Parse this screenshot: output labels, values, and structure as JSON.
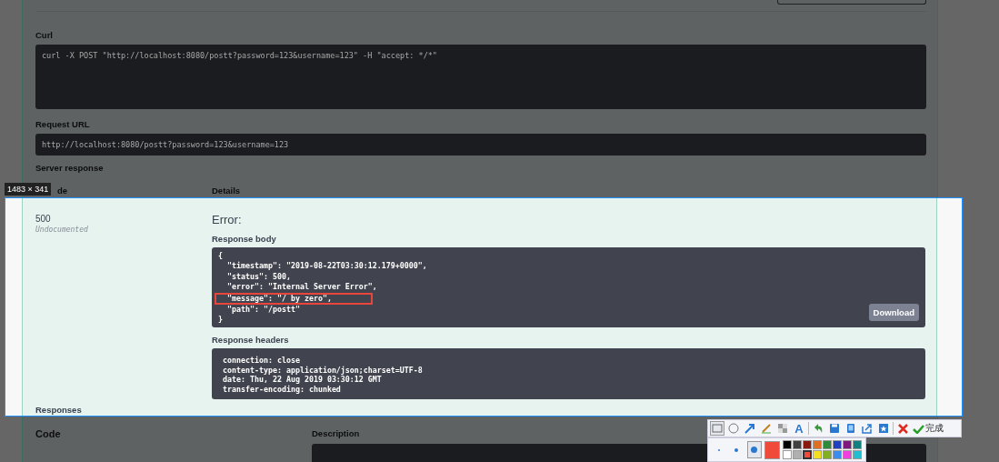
{
  "top_panel": {
    "curl_label": "Curl",
    "curl_command": "curl -X POST \"http://localhost:8080/postt?password=123&username=123\" -H \"accept: */*\"",
    "request_url_label": "Request URL",
    "request_url": "http://localhost:8080/postt?password=123&username=123",
    "server_response_label": "Server response",
    "columns": [
      "de",
      "Details"
    ]
  },
  "server_response": {
    "code": "500",
    "code_note": "Undocumented",
    "details_title": "Error:",
    "response_body_label": "Response body",
    "response_body": [
      {
        "text": "{",
        "highlighted": false
      },
      {
        "text": "  \"timestamp\": \"2019-08-22T03:30:12.179+0000\",",
        "highlighted": false
      },
      {
        "text": "  \"status\": 500,",
        "highlighted": false
      },
      {
        "text": "  \"error\": \"Internal Server Error\",",
        "highlighted": false
      },
      {
        "text": "  \"message\": \"/ by zero\",",
        "highlighted": true
      },
      {
        "text": "  \"path\": \"/postt\"",
        "highlighted": false
      },
      {
        "text": "}",
        "highlighted": false
      }
    ],
    "download_button": "Download",
    "response_headers_label": "Response headers",
    "response_headers": [
      " connection: close",
      " content-type: application/json;charset=UTF-8",
      " date: Thu, 22 Aug 2019 03:30:12 GMT",
      " transfer-encoding: chunked"
    ]
  },
  "responses": {
    "title": "Responses",
    "columns": [
      "Code",
      "Description"
    ]
  },
  "capture_overlay": {
    "size_badge": "1483 × 341",
    "tools": [
      {
        "kind": "rectangle",
        "selected": true
      },
      {
        "kind": "ellipse",
        "selected": false
      },
      {
        "kind": "arrow",
        "selected": false
      },
      {
        "kind": "pen",
        "selected": false
      },
      {
        "kind": "mosaic",
        "selected": false
      },
      {
        "kind": "text",
        "glyph": "A",
        "selected": false
      },
      {
        "kind": "separator"
      },
      {
        "kind": "undo"
      },
      {
        "kind": "save"
      },
      {
        "kind": "pin"
      },
      {
        "kind": "share"
      },
      {
        "kind": "bookmark"
      },
      {
        "kind": "separator"
      },
      {
        "kind": "cancel"
      },
      {
        "kind": "done",
        "label": "完成"
      }
    ],
    "brush_sizes": [
      {
        "selected": false
      },
      {
        "selected": false
      },
      {
        "selected": true
      }
    ],
    "palette": [
      {
        "color": "#000000",
        "selected": false
      },
      {
        "color": "#404040",
        "selected": false
      },
      {
        "color": "#8b1a10",
        "selected": false
      },
      {
        "color": "#e07020",
        "selected": false
      },
      {
        "color": "#2e8b3a",
        "selected": false
      },
      {
        "color": "#2040c0",
        "selected": false
      },
      {
        "color": "#801880",
        "selected": false
      },
      {
        "color": "#108080",
        "selected": false
      },
      {
        "color": "#ffffff",
        "selected": false
      },
      {
        "color": "#b0b0b0",
        "selected": false
      },
      {
        "color": "#f04a3a",
        "selected": true
      },
      {
        "color": "#f0e020",
        "selected": false
      },
      {
        "color": "#80b020",
        "selected": false
      },
      {
        "color": "#3a8cf0",
        "selected": false
      },
      {
        "color": "#f040e0",
        "selected": false
      },
      {
        "color": "#20c0d0",
        "selected": false
      }
    ]
  }
}
